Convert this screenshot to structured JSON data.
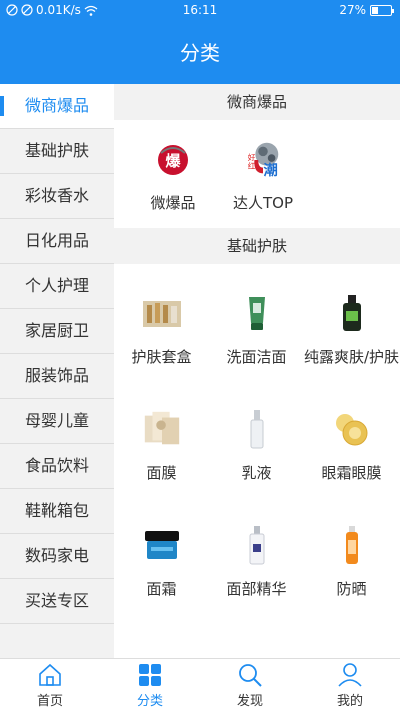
{
  "status_bar": {
    "speed": "0.01K/s",
    "time": "16:11",
    "battery": "27%"
  },
  "header": {
    "title": "分类"
  },
  "sidebar": {
    "items": [
      {
        "label": "微商爆品",
        "active": true
      },
      {
        "label": "基础护肤"
      },
      {
        "label": "彩妆香水"
      },
      {
        "label": "日化用品"
      },
      {
        "label": "个人护理"
      },
      {
        "label": "家居厨卫"
      },
      {
        "label": "服装饰品"
      },
      {
        "label": "母婴儿童"
      },
      {
        "label": "食品饮料"
      },
      {
        "label": "鞋靴箱包"
      },
      {
        "label": "数码家电"
      },
      {
        "label": "买送专区"
      }
    ]
  },
  "sections": [
    {
      "title": "微商爆品",
      "items": [
        {
          "label": "微爆品",
          "icon": "hot-product-icon"
        },
        {
          "label": "达人TOP",
          "icon": "trend-top-icon"
        }
      ]
    },
    {
      "title": "基础护肤",
      "items": [
        {
          "label": "护肤套盒",
          "icon": "gift-box-icon"
        },
        {
          "label": "洗面洁面",
          "icon": "cleanser-tube-icon"
        },
        {
          "label": "纯露爽肤/护肤",
          "icon": "toner-bottle-icon"
        },
        {
          "label": "面膜",
          "icon": "mask-pack-icon"
        },
        {
          "label": "乳液",
          "icon": "lotion-bottle-icon"
        },
        {
          "label": "眼霜眼膜",
          "icon": "eye-patch-icon"
        },
        {
          "label": "面霜",
          "icon": "cream-jar-icon"
        },
        {
          "label": "面部精华",
          "icon": "serum-bottle-icon"
        },
        {
          "label": "防晒",
          "icon": "sunscreen-bottle-icon"
        }
      ]
    }
  ],
  "tabs": [
    {
      "label": "首页",
      "icon": "home-icon"
    },
    {
      "label": "分类",
      "icon": "category-grid-icon",
      "active": true
    },
    {
      "label": "发现",
      "icon": "search-icon"
    },
    {
      "label": "我的",
      "icon": "user-icon"
    }
  ],
  "colors": {
    "accent": "#1e8cf0",
    "text": "#333333",
    "background": "#f2f2f2"
  }
}
